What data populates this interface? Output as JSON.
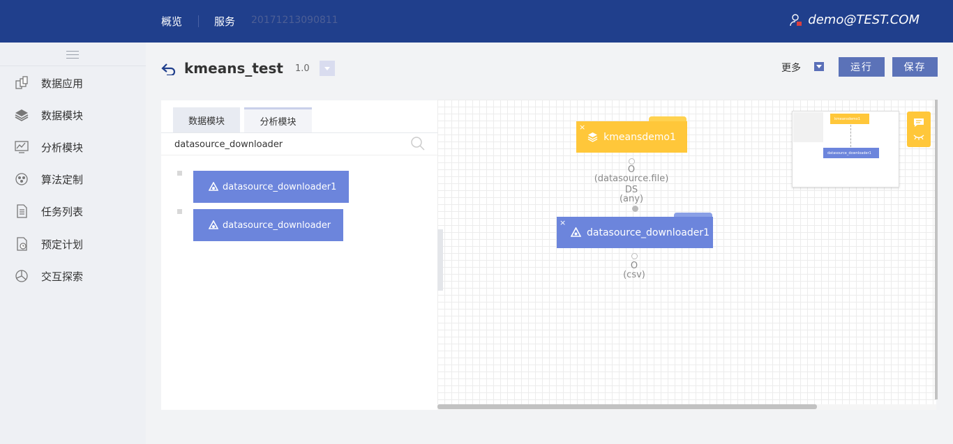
{
  "topbar": {
    "nav_overview": "概览",
    "nav_service": "服务",
    "service_id": "20171213090811",
    "user": "demo@TEST.COM"
  },
  "sidebar": {
    "items": [
      {
        "label": "数据应用",
        "icon": "data-app-icon"
      },
      {
        "label": "数据模块",
        "icon": "layers-icon"
      },
      {
        "label": "分析模块",
        "icon": "analysis-icon"
      },
      {
        "label": "算法定制",
        "icon": "algorithm-icon"
      },
      {
        "label": "任务列表",
        "icon": "task-list-icon"
      },
      {
        "label": "预定计划",
        "icon": "schedule-icon"
      },
      {
        "label": "交互探索",
        "icon": "explore-icon"
      }
    ]
  },
  "header": {
    "project_name": "kmeans_test",
    "version": "1.0",
    "more_label": "更多",
    "run_label": "运行",
    "save_label": "保存"
  },
  "panel": {
    "tabs": [
      "数据模块",
      "分析模块"
    ],
    "search_value": "datasource_downloader",
    "items": [
      "datasource_downloader1",
      "datasource_downloader"
    ]
  },
  "canvas": {
    "node_kmeans": "kmeansdemo1",
    "node_ds": "datasource_downloader1",
    "port_in_labels": [
      "O",
      "(datasource.file)",
      "DS",
      "(any)"
    ],
    "port_out_labels": [
      "O",
      "(csv)"
    ],
    "close_glyph": "×",
    "minimap": {
      "km": "kmeansdemo1",
      "ds": "datasource_downloader1"
    }
  },
  "colors": {
    "topbar": "#203f8c",
    "accent": "#6c85dc",
    "yellow": "#ffc73a",
    "button": "#5b72b8"
  }
}
